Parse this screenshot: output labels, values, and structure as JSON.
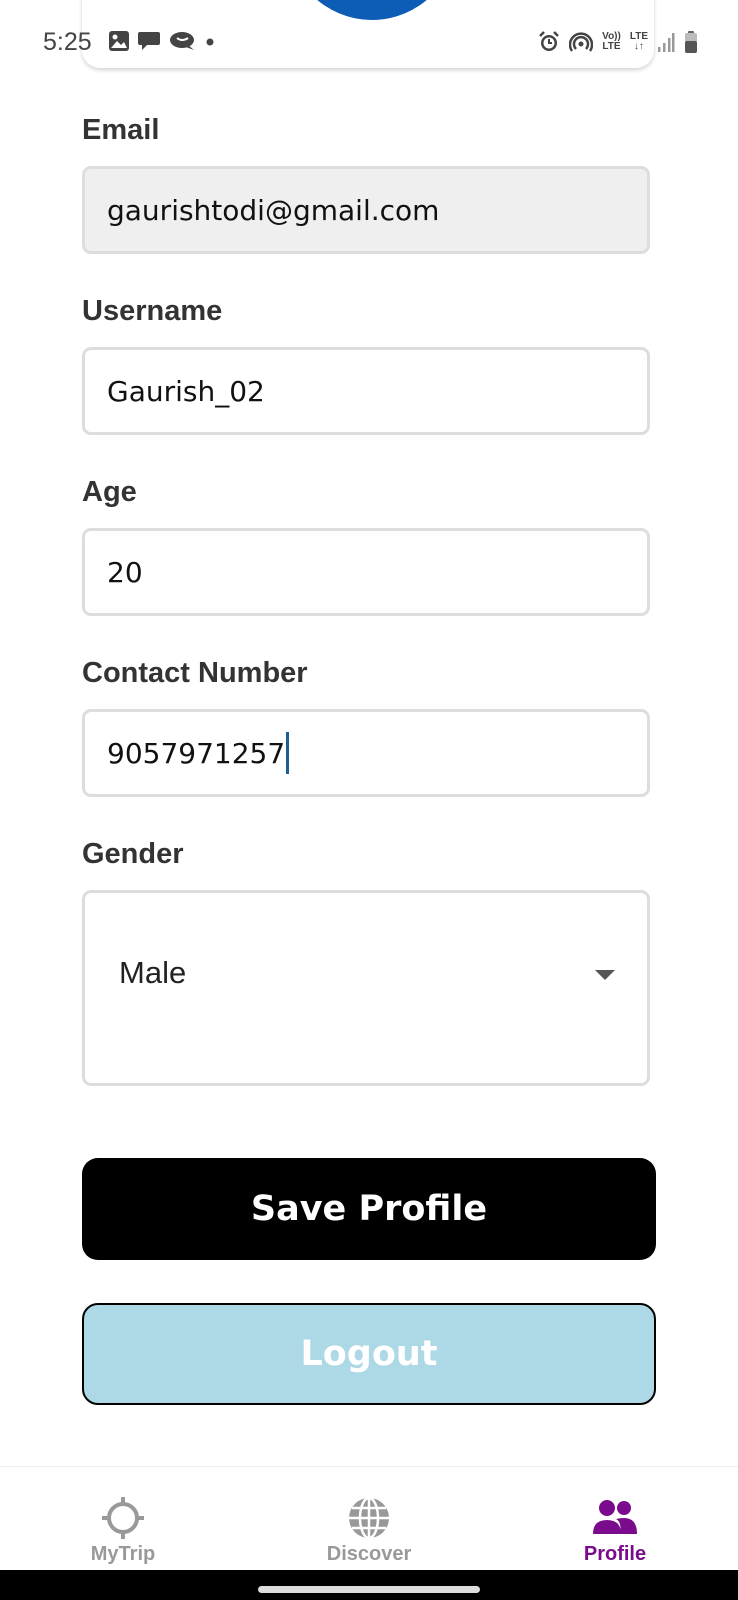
{
  "status_bar": {
    "time": "5:25",
    "left_icons": [
      "image-icon",
      "chat-icon",
      "message-icon",
      "dot-icon"
    ],
    "right_icons": [
      "alarm-icon",
      "hotspot-icon",
      "volte-icon",
      "lte-icon",
      "signal-icon",
      "battery-icon"
    ],
    "volte_label_top": "Vo))",
    "volte_label_bottom": "LTE",
    "lte_label": "LTE"
  },
  "profile_header": {
    "avatar_color": "#0d5cb6"
  },
  "form": {
    "email": {
      "label": "Email",
      "value": "gaurishtodi@gmail.com",
      "disabled": true
    },
    "username": {
      "label": "Username",
      "value": "Gaurish_02"
    },
    "age": {
      "label": "Age",
      "value": "20"
    },
    "contact": {
      "label": "Contact Number",
      "value": "9057971257",
      "focused": true
    },
    "gender": {
      "label": "Gender",
      "selected": "Male"
    }
  },
  "buttons": {
    "save_label": "Save Profile",
    "logout_label": "Logout"
  },
  "colors": {
    "save_bg": "#000000",
    "logout_bg": "#add8e6",
    "active_nav": "#7a0b8c",
    "inactive_nav": "#999999",
    "caret": "#1d5e93"
  },
  "bottom_nav": {
    "items": [
      {
        "label": "MyTrip",
        "icon": "crosshair-icon",
        "active": false
      },
      {
        "label": "Discover",
        "icon": "globe-icon",
        "active": false
      },
      {
        "label": "Profile",
        "icon": "users-icon",
        "active": true
      }
    ]
  }
}
